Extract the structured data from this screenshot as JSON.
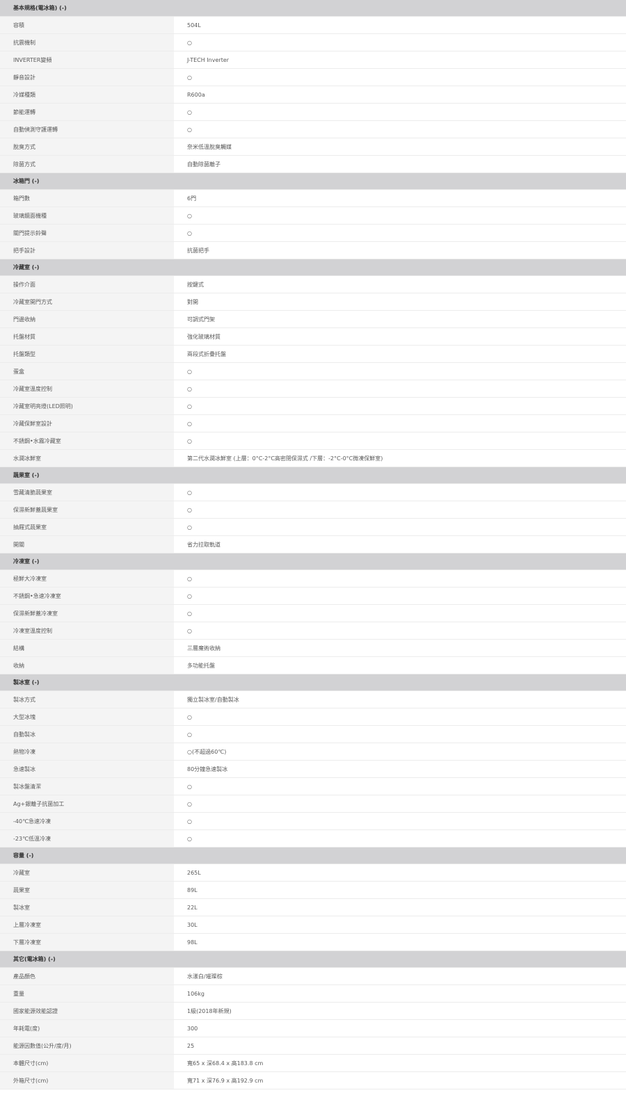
{
  "sections": [
    {
      "title": "基本規格(電冰箱) (-)",
      "rows": [
        {
          "label": "容積",
          "value": "504L"
        },
        {
          "label": "抗震機制",
          "value": "○"
        },
        {
          "label": "INVERTER變頻",
          "value": "J-TECH Inverter"
        },
        {
          "label": "靜音設計",
          "value": "○"
        },
        {
          "label": "冷媒種類",
          "value": "R600a"
        },
        {
          "label": "節能運轉",
          "value": "○"
        },
        {
          "label": "自動偵測守護運轉",
          "value": "○"
        },
        {
          "label": "脫臭方式",
          "value": "奈米低溫脫臭觸媒"
        },
        {
          "label": "除菌方式",
          "value": "自動除菌離子"
        }
      ]
    },
    {
      "title": "冰箱門 (-)",
      "rows": [
        {
          "label": "箱門數",
          "value": "6門"
        },
        {
          "label": "玻璃鏡面機種",
          "value": "○"
        },
        {
          "label": "關門提示鈴聲",
          "value": "○"
        },
        {
          "label": "把手設計",
          "value": "抗菌把手"
        }
      ]
    },
    {
      "title": "冷藏室 (-)",
      "rows": [
        {
          "label": "操作介面",
          "value": "按鍵式"
        },
        {
          "label": "冷藏室開門方式",
          "value": "對開"
        },
        {
          "label": "門邊收納",
          "value": "可調式門架"
        },
        {
          "label": "托盤材質",
          "value": "強化玻璃材質"
        },
        {
          "label": "托盤類型",
          "value": "兩段式折疊托盤"
        },
        {
          "label": "蛋盒",
          "value": "○"
        },
        {
          "label": "冷藏室溫度控制",
          "value": "○"
        },
        {
          "label": "冷藏室明亮燈(LED照明)",
          "value": "○"
        },
        {
          "label": "冷藏保鮮室設計",
          "value": "○"
        },
        {
          "label": "不銹鋼•水霧冷藏室",
          "value": "○"
        },
        {
          "label": "水潤冰鮮室",
          "value": "第二代水潤冰鮮室 (上層：0°C-2°C高密閉保濕式 /下層：-2°C-0°C微凍保鮮室)"
        }
      ]
    },
    {
      "title": "蔬果室 (-)",
      "rows": [
        {
          "label": "雪藏清脆蔬果室",
          "value": "○"
        },
        {
          "label": "保濕新鮮蓋蔬果室",
          "value": "○"
        },
        {
          "label": "抽屜式蔬果室",
          "value": "○"
        },
        {
          "label": "開關",
          "value": "省力拉取軌道"
        }
      ]
    },
    {
      "title": "冷凍室 (-)",
      "rows": [
        {
          "label": "極鮮大冷凍室",
          "value": "○"
        },
        {
          "label": "不銹鋼•急速冷凍室",
          "value": "○"
        },
        {
          "label": "保濕新鮮蓋冷凍室",
          "value": "○"
        },
        {
          "label": "冷凍室溫度控制",
          "value": "○"
        },
        {
          "label": "結構",
          "value": "三層魔術收納"
        },
        {
          "label": "收納",
          "value": "多功能托盤"
        }
      ]
    },
    {
      "title": "製冰室 (-)",
      "rows": [
        {
          "label": "製冰方式",
          "value": "獨立製冰室/自動製冰"
        },
        {
          "label": "大型冰塊",
          "value": "○"
        },
        {
          "label": "自動製冰",
          "value": "○"
        },
        {
          "label": "熱物冷凍",
          "value": "○(不超過60℃)"
        },
        {
          "label": "急速製冰",
          "value": "80分鐘急速製冰"
        },
        {
          "label": "製冰盤清潔",
          "value": "○"
        },
        {
          "label": "Ag+銀離子抗菌加工",
          "value": "○"
        },
        {
          "label": "-40℃急速冷凍",
          "value": "○"
        },
        {
          "label": "-23℃低溫冷凍",
          "value": "○"
        }
      ]
    },
    {
      "title": "容量 (-)",
      "rows": [
        {
          "label": "冷藏室",
          "value": "265L"
        },
        {
          "label": "蔬果室",
          "value": "89L"
        },
        {
          "label": "製冰室",
          "value": "22L"
        },
        {
          "label": "上層冷凍室",
          "value": "30L"
        },
        {
          "label": "下層冷凍室",
          "value": "98L"
        }
      ]
    },
    {
      "title": "其它(電冰箱) (-)",
      "rows": [
        {
          "label": "產品顏色",
          "value": "水漾白/璀璨棕"
        },
        {
          "label": "重量",
          "value": "106kg"
        },
        {
          "label": "國家能源效能認證",
          "value": "1級(2018年新規)"
        },
        {
          "label": "年耗電(度)",
          "value": "300"
        },
        {
          "label": "能源因數值(公升/度/月)",
          "value": "25"
        },
        {
          "label": "本體尺寸(cm)",
          "value": "寬65 x 深68.4 x 高183.8 cm"
        },
        {
          "label": "外箱尺寸(cm)",
          "value": "寬71 x 深76.9 x 高192.9 cm"
        }
      ]
    }
  ]
}
